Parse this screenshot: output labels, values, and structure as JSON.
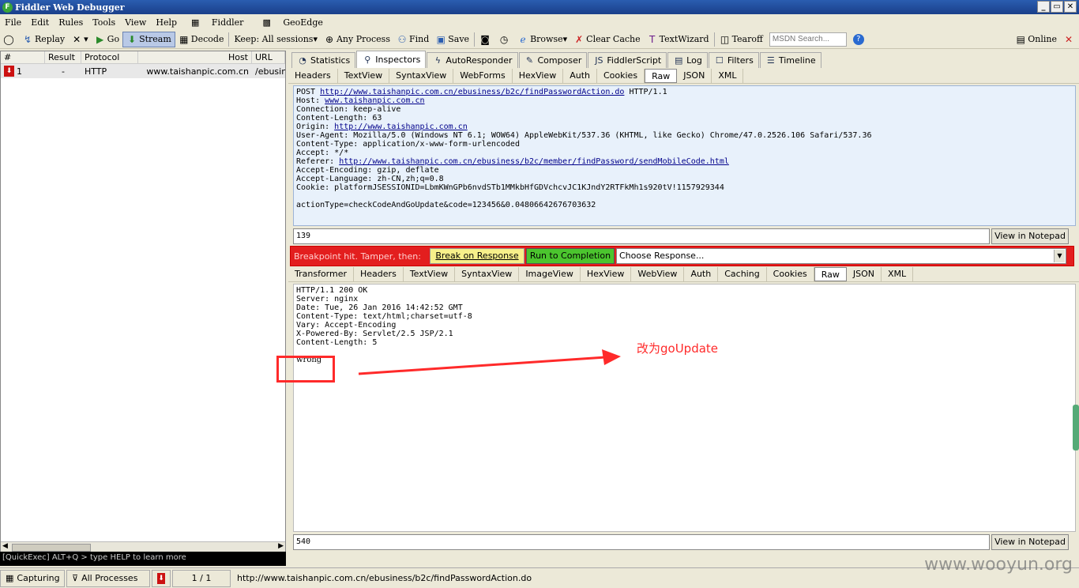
{
  "window": {
    "title": "Fiddler Web Debugger",
    "controls": [
      "_",
      "▭",
      "✕"
    ]
  },
  "menu": [
    "File",
    "Edit",
    "Rules",
    "Tools",
    "View",
    "Help",
    "Fiddler",
    "GeoEdge"
  ],
  "toolbar": {
    "replay": "Replay",
    "go": "Go",
    "stream": "Stream",
    "decode": "Decode",
    "keep": "Keep: All sessions",
    "any_process": "Any Process",
    "find": "Find",
    "save": "Save",
    "browse": "Browse",
    "clear_cache": "Clear Cache",
    "textwizard": "TextWizard",
    "tearoff": "Tearoff",
    "msdn_placeholder": "MSDN Search...",
    "online": "Online"
  },
  "sessions": {
    "columns": [
      "#",
      "Result",
      "Protocol",
      "Host",
      "URL"
    ],
    "rows": [
      {
        "num": "1",
        "result": "-",
        "protocol": "HTTP",
        "host": "www.taishanpic.com.cn",
        "url": "/ebusin"
      }
    ]
  },
  "quickexec": "[QuickExec] ALT+Q > type HELP to learn more",
  "main_tabs": [
    "Statistics",
    "Inspectors",
    "AutoResponder",
    "Composer",
    "FiddlerScript",
    "Log",
    "Filters",
    "Timeline"
  ],
  "request_tabs": [
    "Headers",
    "TextView",
    "SyntaxView",
    "WebForms",
    "HexView",
    "Auth",
    "Cookies",
    "Raw",
    "JSON",
    "XML"
  ],
  "request": {
    "line_prefix": "POST ",
    "url": "http://www.taishanpic.com.cn/ebusiness/b2c/findPasswordAction.do",
    "line_suffix": " HTTP/1.1",
    "host_label": "Host: ",
    "host": "www.taishanpic.com.cn",
    "connection": "Connection: keep-alive",
    "content_length": "Content-Length: 63",
    "origin_label": "Origin: ",
    "origin": "http://www.taishanpic.com.cn",
    "user_agent": "User-Agent: Mozilla/5.0 (Windows NT 6.1; WOW64) AppleWebKit/537.36 (KHTML, like Gecko) Chrome/47.0.2526.106 Safari/537.36",
    "content_type": "Content-Type: application/x-www-form-urlencoded",
    "accept": "Accept: */*",
    "referer_label": "Referer: ",
    "referer": "http://www.taishanpic.com.cn/ebusiness/b2c/member/findPassword/sendMobileCode.html",
    "accept_encoding": "Accept-Encoding: gzip, deflate",
    "accept_language": "Accept-Language: zh-CN,zh;q=0.8",
    "cookie": "Cookie: platformJSESSIONID=LbmKWnGPb6nvdSTb1MMkbHfGDVchcvJC1KJndY2RTFkMh1s920tV!1157929344",
    "body": "actionType=checkCodeAndGoUpdate&code=123456&0.04806642676703632",
    "count": "139",
    "view_notepad": "View in Notepad"
  },
  "breakpoint": {
    "text": "Breakpoint hit. Tamper, then:",
    "break_on_response": "Break on Response",
    "run_to_completion": "Run to Completion",
    "choose_response": "Choose Response..."
  },
  "response_tabs": [
    "Transformer",
    "Headers",
    "TextView",
    "SyntaxView",
    "ImageView",
    "HexView",
    "WebView",
    "Auth",
    "Caching",
    "Cookies",
    "Raw",
    "JSON",
    "XML"
  ],
  "response": {
    "lines": [
      "HTTP/1.1 200 OK",
      "Server: nginx",
      "Date: Tue, 26 Jan 2016 14:42:52 GMT",
      "Content-Type: text/html;charset=utf-8",
      "Vary: Accept-Encoding",
      "X-Powered-By: Servlet/2.5 JSP/2.1",
      "Content-Length: 5"
    ],
    "body": "wrong",
    "count": "540",
    "view_notepad": "View in Notepad"
  },
  "annotation": "改为goUpdate",
  "status": {
    "capturing": "Capturing",
    "processes": "All Processes",
    "count": "1 / 1",
    "url": "http://www.taishanpic.com.cn/ebusiness/b2c/findPasswordAction.do"
  },
  "watermark": "www.wooyun.org",
  "colors": {
    "breakpoint_bar": "#e31e1e",
    "annotation": "#ff2a2a",
    "raw_bg": "#e8f1fb"
  }
}
